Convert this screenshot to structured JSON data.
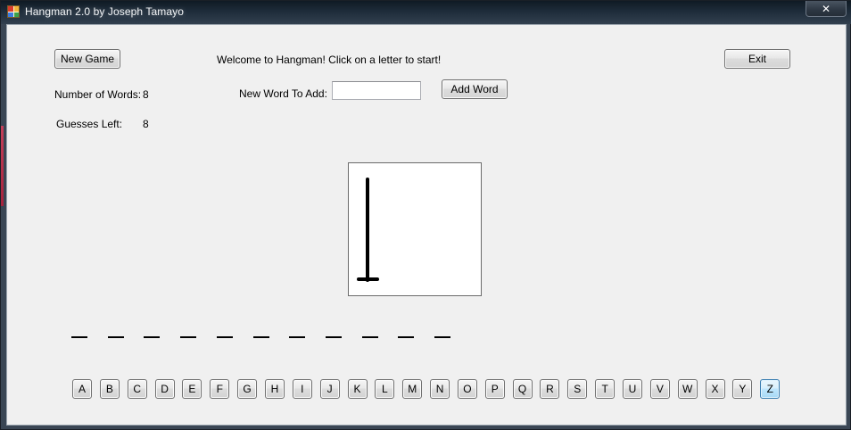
{
  "window": {
    "title": "Hangman 2.0 by Joseph Tamayo",
    "close_glyph": "✕",
    "icon": "app-icon"
  },
  "controls": {
    "new_game_label": "New Game",
    "exit_label": "Exit",
    "add_word_label": "Add Word",
    "welcome_text": "Welcome to Hangman! Click on a letter to start!"
  },
  "stats": {
    "words_label": "Number of Words:",
    "words_value": "8",
    "guesses_label": "Guesses Left:",
    "guesses_value": "8"
  },
  "new_word": {
    "label": "New Word To Add:",
    "value": ""
  },
  "word": {
    "blank_count": 11,
    "blank_glyph": "_"
  },
  "letters": [
    "A",
    "B",
    "C",
    "D",
    "E",
    "F",
    "G",
    "H",
    "I",
    "J",
    "K",
    "L",
    "M",
    "N",
    "O",
    "P",
    "Q",
    "R",
    "S",
    "T",
    "U",
    "V",
    "W",
    "X",
    "Y",
    "Z"
  ],
  "focused_letter": "Z",
  "gallows": {
    "stage": "pole",
    "stroke_color": "#000000"
  },
  "colors": {
    "client_bg": "#f0f0f0",
    "focus_border": "#3c7fb1"
  }
}
